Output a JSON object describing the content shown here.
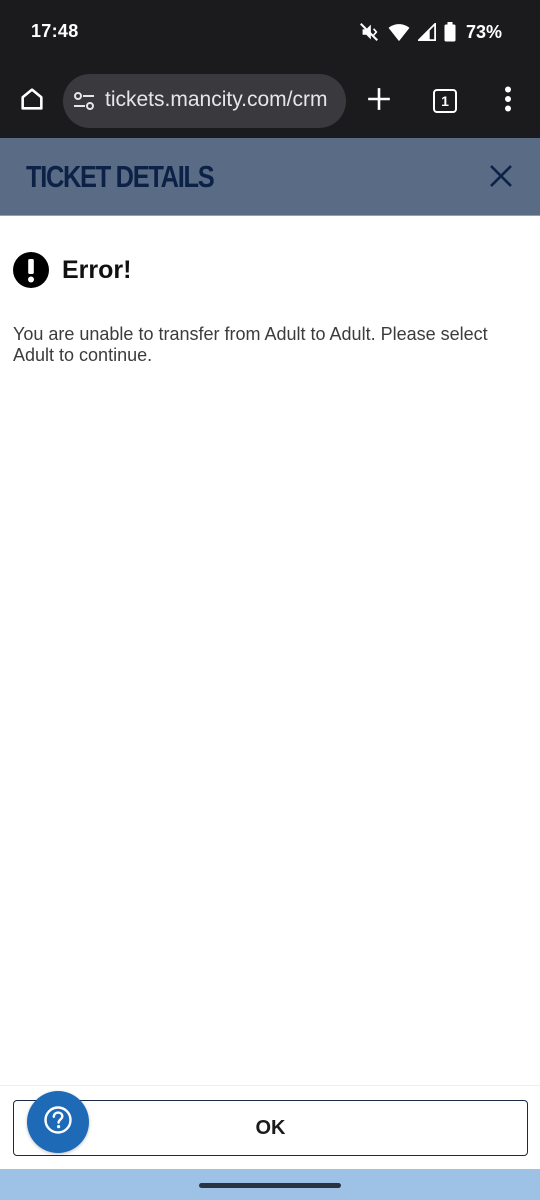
{
  "status_bar": {
    "time": "17:48",
    "battery_percent": "73%",
    "icons": [
      "mute-vibrate-icon",
      "wifi-icon",
      "cell-signal-icon",
      "battery-icon"
    ]
  },
  "browser": {
    "url": "tickets.mancity.com/crm",
    "tab_count": "1",
    "icons": [
      "home-icon",
      "site-settings-icon",
      "plus-icon",
      "tab-switcher-icon",
      "more-vert-icon"
    ]
  },
  "header": {
    "title": "TICKET DETAILS",
    "background_color": "#596b85",
    "title_color": "#0b2246"
  },
  "error": {
    "title": "Error!",
    "message": "You are unable to transfer from Adult to Adult. Please select Adult to continue."
  },
  "footer": {
    "ok_label": "OK",
    "help_color": "#1f6ab7",
    "nav_bar_color": "#9dc2e6"
  }
}
